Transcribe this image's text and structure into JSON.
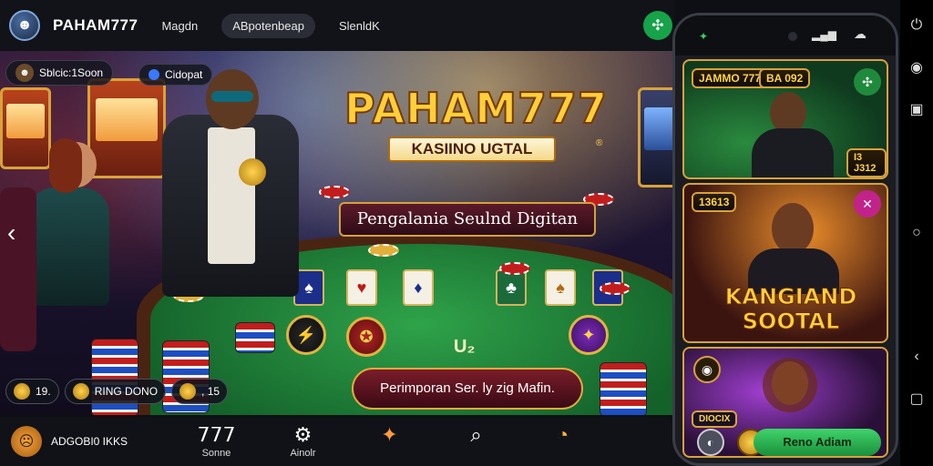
{
  "topbar": {
    "brand": "PAHAM777",
    "nav": [
      "Magdn",
      "ABpotenbeap",
      "SlenldK"
    ]
  },
  "hero": {
    "player_pill": "Sblcic:1Soon",
    "online_pill": "Cidopat",
    "title": "PAHAM777",
    "subtitle": "KASIINO UGTAL",
    "reg": "®",
    "tagline": "Pengalania Seulnd Digitan",
    "table_text": "U₂",
    "cta": "Perimporan Ser. ly zig Mafin."
  },
  "status": {
    "balance": "19.",
    "bonus": "RING DONO",
    "wins": ", 15"
  },
  "bottom_nav": {
    "user_label": "ADGOBI0 IKKS",
    "items": [
      {
        "icon": "𝟩𝟩𝟩",
        "label": "Sonne"
      },
      {
        "icon": "⚙",
        "label": "Ainolr"
      },
      {
        "icon": "✦",
        "label": ""
      },
      {
        "icon": "⌕",
        "label": ""
      },
      {
        "icon": "◔",
        "label": ""
      }
    ]
  },
  "phone": {
    "card1_badge": "JAMMO 777",
    "card1_badge2": "BA 092",
    "card1_tag": "I3 J312",
    "card2_badge": "13613",
    "card2_title": "KANGIAND SOOTAL",
    "card3_label": "DIOCIX",
    "card3_cta": "Reno Adiam"
  },
  "colors": {
    "accent_gold": "#ffcf3a",
    "felt_green": "#1f7a37",
    "cta_green": "#2eb556"
  }
}
